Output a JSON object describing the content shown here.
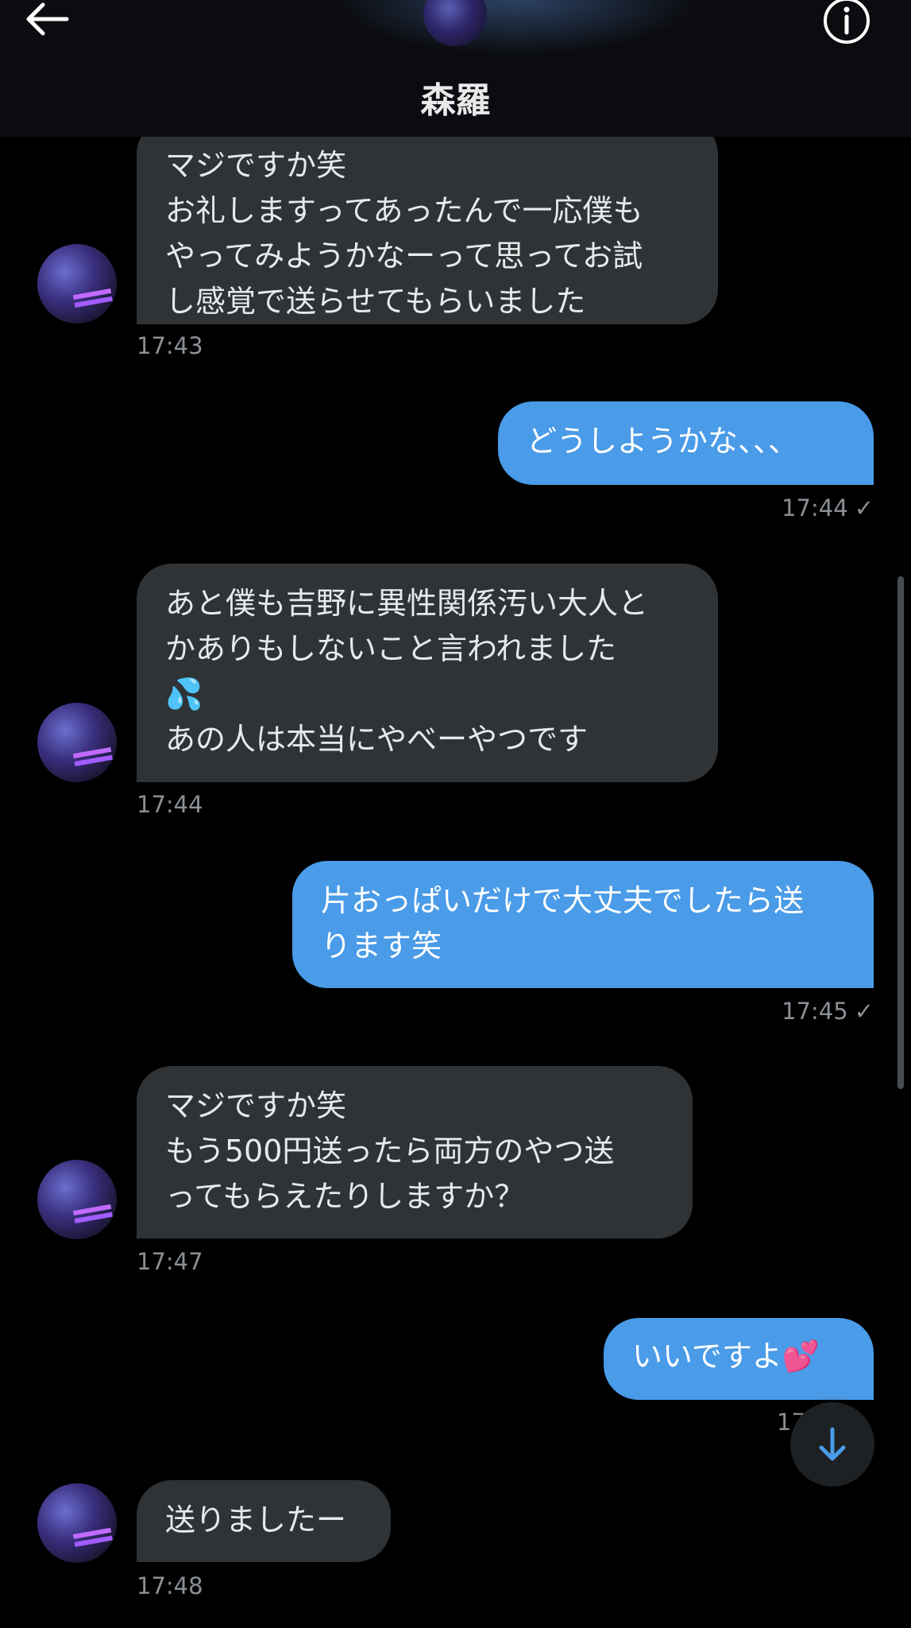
{
  "header": {
    "title": "森羅",
    "back_icon": "arrow-left-icon",
    "info_icon": "info-icon"
  },
  "messages": [
    {
      "direction": "in",
      "text": "マジですか笑\nお礼しますってあったんで一応僕も\nやってみようかなーって思ってお試\nし感覚で送らせてもらいました",
      "time": "17:43"
    },
    {
      "direction": "out",
      "text": "どうしようかな、、、",
      "time": "17:44"
    },
    {
      "direction": "in",
      "text": "あと僕も吉野に異性関係汚い大人と\nかありもしないこと言われました\n💦\nあの人は本当にやべーやつです",
      "time": "17:44"
    },
    {
      "direction": "out",
      "text": "片おっぱいだけで大丈夫でしたら送\nります笑",
      "time": "17:45"
    },
    {
      "direction": "in",
      "text": "マジですか笑\nもう500円送ったら両方のやつ送\nってもらえたりしますか？",
      "time": "17:47"
    },
    {
      "direction": "out",
      "text": "いいですよ💕",
      "time": "17:"
    },
    {
      "direction": "in",
      "text": "送りましたー",
      "time": "17:48"
    }
  ],
  "colors": {
    "background": "#000000",
    "incoming_bubble": "#2f3336",
    "outgoing_bubble": "#4a9be8",
    "timestamp": "#8b9096"
  },
  "icons": {
    "sent_check": "checkmark-icon",
    "scroll_down": "arrow-down-icon"
  }
}
